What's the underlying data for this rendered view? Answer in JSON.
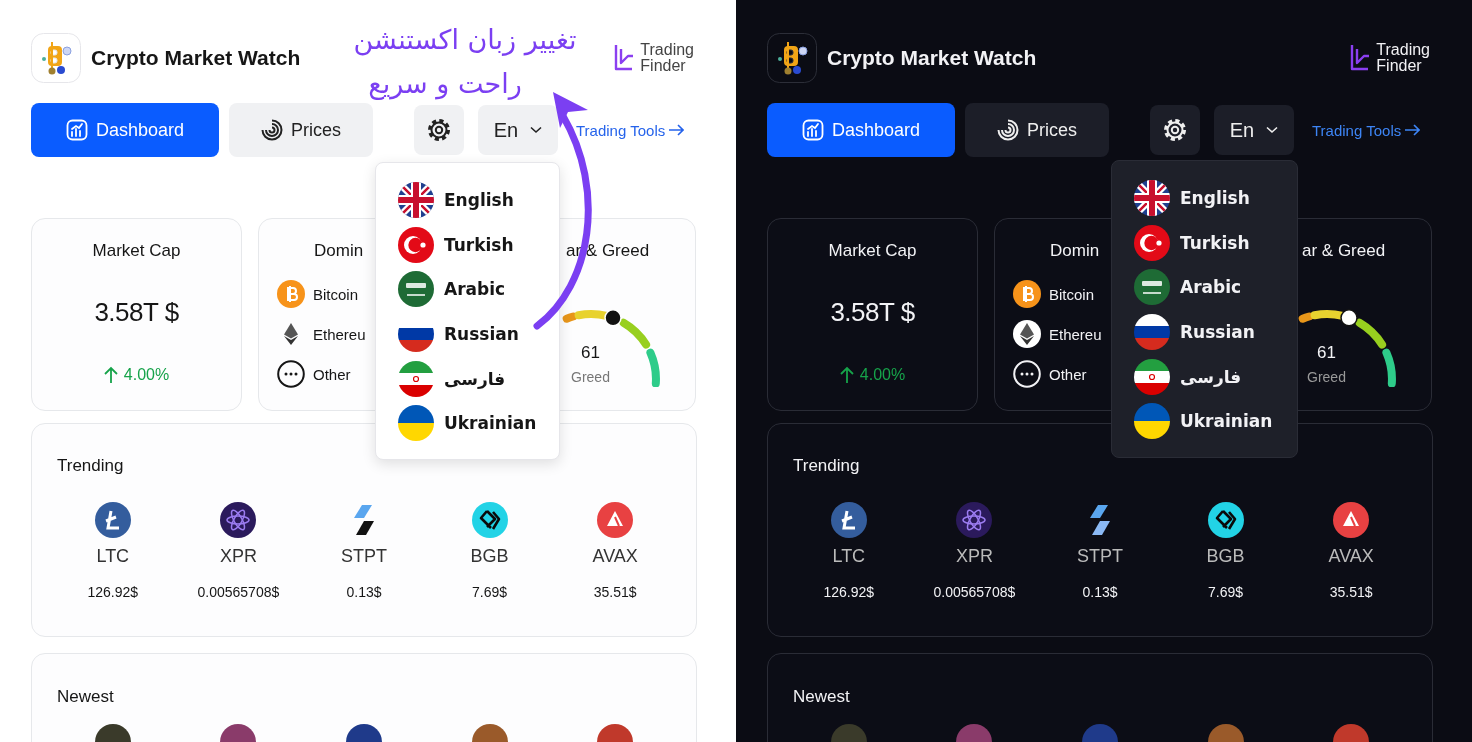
{
  "annotation": {
    "lines": [
      "تغییر زبان اکستنشن",
      "راحت و سریع"
    ]
  },
  "panels": [
    {
      "dark_mode": false,
      "app_title": "Crypto Market Watch",
      "brand": {
        "lines": [
          "Trading",
          "Finder"
        ]
      },
      "nav": {
        "tabs": [
          {
            "label": "Dashboard",
            "kind": "dashboard",
            "selected": true
          },
          {
            "label": "Prices",
            "kind": "prices",
            "selected": false
          }
        ],
        "language": "En",
        "link": "Trading Tools"
      },
      "language_menu": [
        {
          "label": "English",
          "kind": "uk"
        },
        {
          "label": "Turkish",
          "kind": "tr"
        },
        {
          "label": "Arabic",
          "kind": "sa"
        },
        {
          "label": "Russian",
          "kind": "ru"
        },
        {
          "label": "فارسی",
          "kind": "ir"
        },
        {
          "label": "Ukrainian",
          "kind": "ua"
        }
      ],
      "market_cap": {
        "title": "Market Cap",
        "value": "3.58T $",
        "change": "4.00%",
        "rising": true
      },
      "dominance": {
        "title": "Domin",
        "items": [
          {
            "label": "Bitcoin",
            "kind": "bitcoin"
          },
          {
            "label": "Ethereu",
            "kind": "ethereum"
          },
          {
            "label": "Other",
            "kind": "other"
          }
        ]
      },
      "fear_greed": {
        "title": "ar & Greed",
        "value": "61",
        "label": "Greed"
      },
      "trending": {
        "title": "Trending",
        "coins": [
          {
            "symbol": "LTC",
            "price": "126.92$",
            "kind": "ltc"
          },
          {
            "symbol": "XPR",
            "price": "0.00565708$",
            "kind": "xpr"
          },
          {
            "symbol": "STPT",
            "price": "0.13$",
            "kind": "stpt"
          },
          {
            "symbol": "BGB",
            "price": "7.69$",
            "kind": "bgb"
          },
          {
            "symbol": "AVAX",
            "price": "35.51$",
            "kind": "avax"
          }
        ]
      },
      "newest": {
        "title": "Newest"
      }
    },
    {
      "dark_mode": true,
      "app_title": "Crypto Market Watch",
      "brand": {
        "lines": [
          "Trading",
          "Finder"
        ]
      },
      "nav": {
        "tabs": [
          {
            "label": "Dashboard",
            "kind": "dashboard",
            "selected": true
          },
          {
            "label": "Prices",
            "kind": "prices",
            "selected": false
          }
        ],
        "language": "En",
        "link": "Trading Tools"
      },
      "language_menu": [
        {
          "label": "English",
          "kind": "uk"
        },
        {
          "label": "Turkish",
          "kind": "tr"
        },
        {
          "label": "Arabic",
          "kind": "sa"
        },
        {
          "label": "Russian",
          "kind": "ru"
        },
        {
          "label": "فارسی",
          "kind": "ir"
        },
        {
          "label": "Ukrainian",
          "kind": "ua"
        }
      ],
      "market_cap": {
        "title": "Market Cap",
        "value": "3.58T $",
        "change": "4.00%",
        "rising": true
      },
      "dominance": {
        "title": "Domin",
        "items": [
          {
            "label": "Bitcoin",
            "kind": "bitcoin"
          },
          {
            "label": "Ethereu",
            "kind": "ethereum"
          },
          {
            "label": "Other",
            "kind": "other"
          }
        ]
      },
      "fear_greed": {
        "title": "ar & Greed",
        "value": "61",
        "label": "Greed"
      },
      "trending": {
        "title": "Trending",
        "coins": [
          {
            "symbol": "LTC",
            "price": "126.92$",
            "kind": "ltc"
          },
          {
            "symbol": "XPR",
            "price": "0.00565708$",
            "kind": "xpr"
          },
          {
            "symbol": "STPT",
            "price": "0.13$",
            "kind": "stpt"
          },
          {
            "symbol": "BGB",
            "price": "7.69$",
            "kind": "bgb"
          },
          {
            "symbol": "AVAX",
            "price": "35.51$",
            "kind": "avax"
          }
        ]
      },
      "newest": {
        "title": "Newest"
      }
    }
  ]
}
